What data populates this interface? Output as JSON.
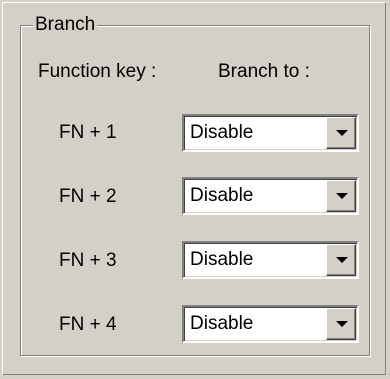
{
  "group": {
    "title": "Branch"
  },
  "headers": {
    "function_key": "Function key :",
    "branch_to": "Branch to :"
  },
  "rows": [
    {
      "label": "FN + 1",
      "value": "Disable"
    },
    {
      "label": "FN + 2",
      "value": "Disable"
    },
    {
      "label": "FN + 3",
      "value": "Disable"
    },
    {
      "label": "FN + 4",
      "value": "Disable"
    }
  ],
  "icons": {
    "dropdown": "chevron-down-icon"
  }
}
